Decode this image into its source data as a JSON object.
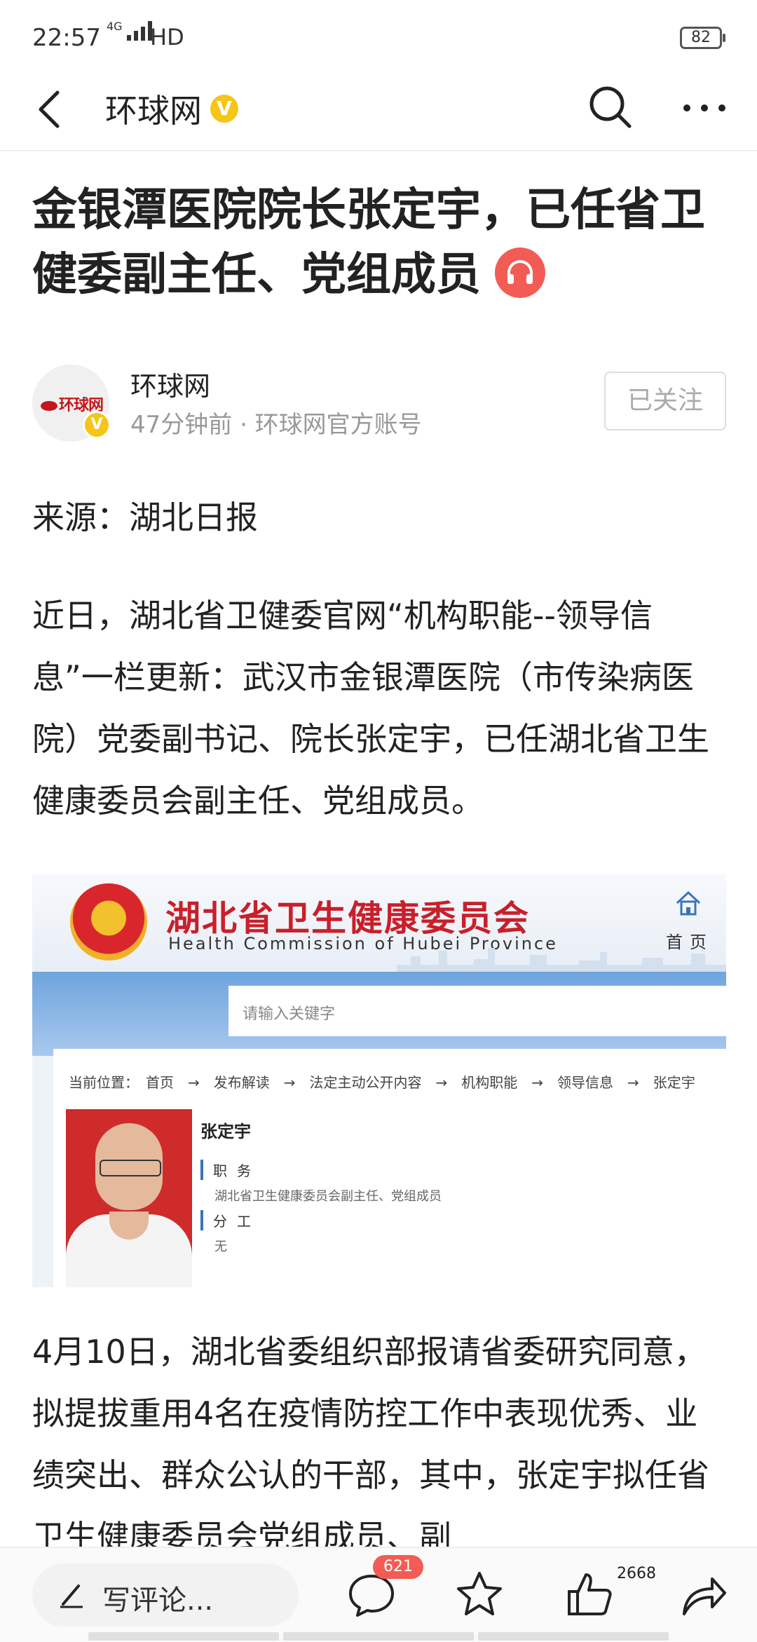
{
  "status_bar": {
    "time": "22:57",
    "network": "4G",
    "hd": "HD",
    "battery": "82"
  },
  "nav": {
    "title": "环球网",
    "verified": "V"
  },
  "article": {
    "title": "金银潭医院院长张定宇，已任省卫健委副主任、党组成员",
    "author": {
      "name": "环球网",
      "logo_text": "环球网",
      "meta": "47分钟前 · 环球网官方账号",
      "follow_label": "已关注",
      "verified": "V"
    },
    "source": "来源：湖北日报",
    "paragraph_1": "近日，湖北省卫健委官网“机构职能--领导信息”一栏更新：武汉市金银潭医院（市传染病医院）党委副书记、院长张定宇，已任湖北省卫生健康委员会副主任、党组成员。",
    "paragraph_2": "4月10日，湖北省委组织部报请省委研究同意，拟提拔重用4名在疫情防控工作中表现优秀、业绩突出、群众公认的干部，其中，张定宇拟任省卫生健康委员会党组成员、副"
  },
  "screenshot": {
    "org_cn": "湖北省卫生健康委员会",
    "org_en": "Health Commission of Hubei Province",
    "home_label": "首页",
    "search_placeholder": "请输入关键字",
    "breadcrumb": "当前位置：　首页　→　发布解读　→　法定主动公开内容　→　机构职能　→　领导信息　→　张定宇",
    "person_name": "张定宇",
    "duty_label": "职务",
    "duty_value": "湖北省卫生健康委员会副主任、党组成员",
    "division_label": "分工",
    "division_value": "无"
  },
  "bottom_bar": {
    "comment_placeholder": "写评论...",
    "comment_count": "621",
    "like_count": "2668"
  },
  "colors": {
    "accent_red": "#f25c54",
    "verified_yellow": "#f5c518",
    "org_red": "#c8202a"
  }
}
